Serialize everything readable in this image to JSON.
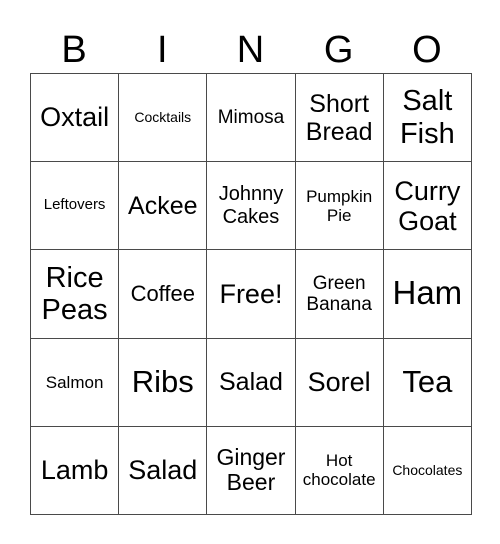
{
  "header": [
    "B",
    "I",
    "N",
    "G",
    "O"
  ],
  "cells": [
    [
      {
        "text": "Oxtail",
        "size": 27
      },
      {
        "text": "Cocktails",
        "size": 14
      },
      {
        "text": "Mimosa",
        "size": 19
      },
      {
        "text": "Short Bread",
        "size": 25
      },
      {
        "text": "Salt Fish",
        "size": 29
      }
    ],
    [
      {
        "text": "Leftovers",
        "size": 15
      },
      {
        "text": "Ackee",
        "size": 25
      },
      {
        "text": "Johnny Cakes",
        "size": 20
      },
      {
        "text": "Pumpkin Pie",
        "size": 17
      },
      {
        "text": "Curry Goat",
        "size": 27
      }
    ],
    [
      {
        "text": "Rice Peas",
        "size": 29
      },
      {
        "text": "Coffee",
        "size": 22
      },
      {
        "text": "Free!",
        "size": 27
      },
      {
        "text": "Green Banana",
        "size": 19
      },
      {
        "text": "Ham",
        "size": 33
      }
    ],
    [
      {
        "text": "Salmon",
        "size": 17
      },
      {
        "text": "Ribs",
        "size": 31
      },
      {
        "text": "Salad",
        "size": 25
      },
      {
        "text": "Sorel",
        "size": 27
      },
      {
        "text": "Tea",
        "size": 31
      }
    ],
    [
      {
        "text": "Lamb",
        "size": 27
      },
      {
        "text": "Salad",
        "size": 27
      },
      {
        "text": "Ginger Beer",
        "size": 23
      },
      {
        "text": "Hot chocolate",
        "size": 17
      },
      {
        "text": "Chocolates",
        "size": 14
      }
    ]
  ]
}
